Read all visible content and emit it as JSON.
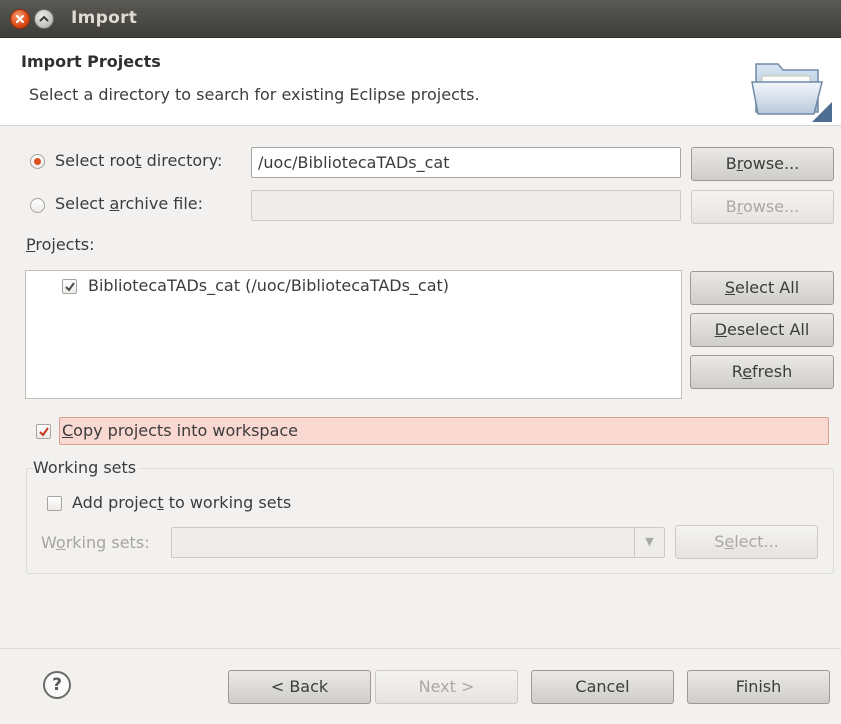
{
  "window": {
    "title": "Import"
  },
  "header": {
    "title": "Import Projects",
    "description": "Select a directory to search for existing Eclipse projects.",
    "icon": "folder-open-icon"
  },
  "source": {
    "root_directory": {
      "label_pre": "Select roo",
      "label_mnemonic": "t",
      "label_post": " directory:",
      "selected": true,
      "value": "/uoc/BibliotecaTADs_cat",
      "browse_pre": "B",
      "browse_mnemonic": "r",
      "browse_post": "owse..."
    },
    "archive_file": {
      "label_pre": "Select ",
      "label_mnemonic": "a",
      "label_post": "rchive file:",
      "selected": false,
      "value": "",
      "browse_pre": "B",
      "browse_mnemonic": "r",
      "browse_post": "owse..."
    }
  },
  "projects": {
    "label_mnemonic": "P",
    "label_post": "rojects:",
    "items": [
      {
        "label": "BibliotecaTADs_cat (/uoc/BibliotecaTADs_cat)",
        "checked": true
      }
    ],
    "select_all_mnemonic": "S",
    "select_all_post": "elect All",
    "deselect_all_mnemonic": "D",
    "deselect_all_post": "eselect All",
    "refresh_pre": "R",
    "refresh_mnemonic": "e",
    "refresh_post": "fresh"
  },
  "copy_projects": {
    "label_mnemonic": "C",
    "label_post": "opy projects into workspace",
    "checked": true
  },
  "working_sets": {
    "group_label": "Working sets",
    "add_label_pre": "Add projec",
    "add_label_mnemonic": "t",
    "add_label_post": " to working sets",
    "add_checked": false,
    "sets_label_pre": "W",
    "sets_label_mnemonic": "o",
    "sets_label_post": "rking sets:",
    "sets_value": "",
    "select_pre": "S",
    "select_mnemonic": "e",
    "select_post": "lect..."
  },
  "footer": {
    "help": "?",
    "back": "< Back",
    "next": "Next >",
    "cancel": "Cancel",
    "finish": "Finish"
  },
  "colors": {
    "accent": "#e0501e",
    "titlebar": "#4a4945",
    "highlight": "#f8d8d1"
  }
}
